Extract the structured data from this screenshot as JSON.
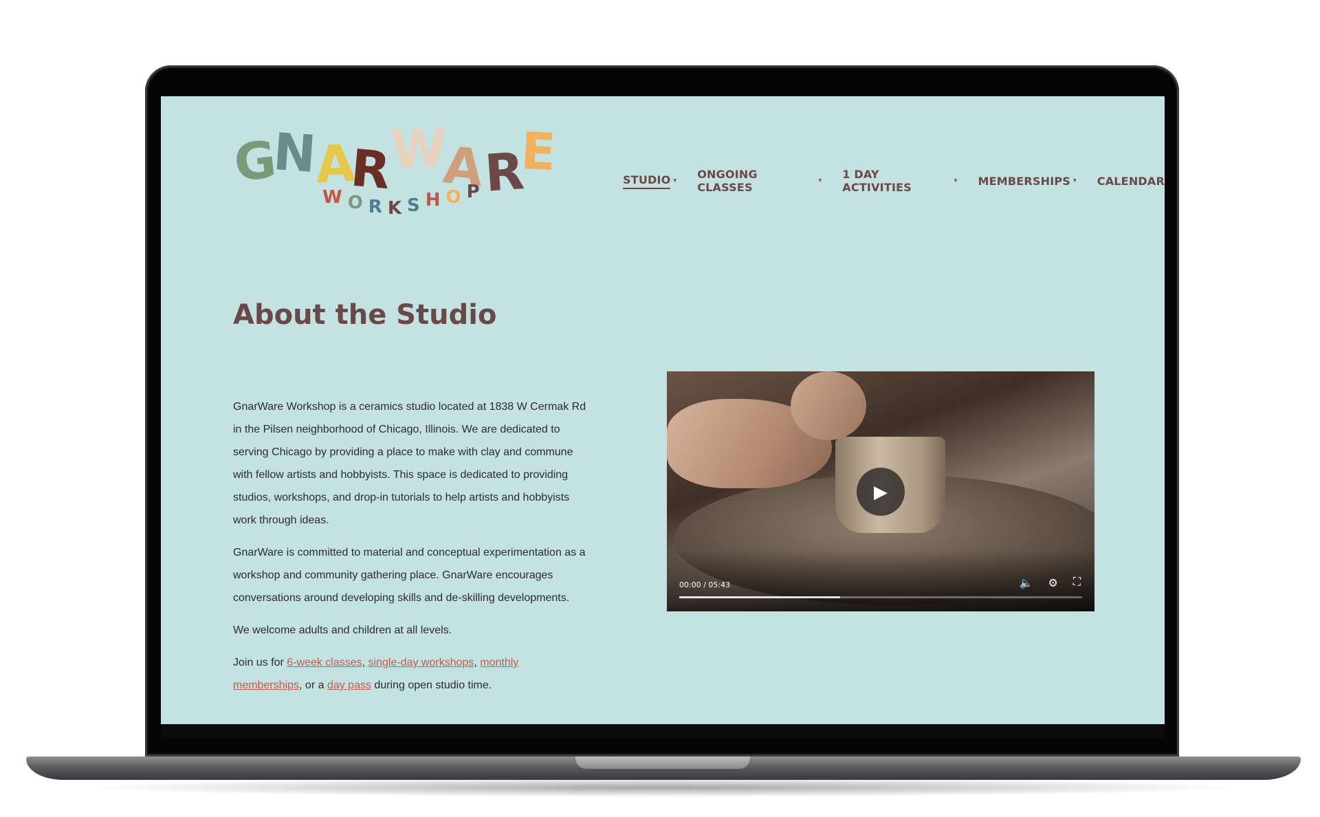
{
  "logo": {
    "main_letters": [
      "G",
      "N",
      "A",
      "R",
      "W",
      "A",
      "R",
      "E"
    ],
    "main_colors": [
      "#7a9a7a",
      "#6b8c8c",
      "#e5c84a",
      "#6b2e25",
      "#e8d2bf",
      "#cf9f7a",
      "#6b4848",
      "#f2b15e"
    ],
    "sub_letters": [
      "W",
      "O",
      "R",
      "K",
      "S",
      "H",
      "O",
      "P"
    ],
    "sub_colors": [
      "#c0564a",
      "#7a9a7a",
      "#4f7f8f",
      "#6b4848",
      "#4f7f8f",
      "#c0564a",
      "#f2b15e",
      "#6b4848"
    ]
  },
  "nav": {
    "items": [
      {
        "label": "STUDIO",
        "caret": true,
        "active": true
      },
      {
        "label": "ONGOING CLASSES",
        "caret": true,
        "active": false
      },
      {
        "label": "1 DAY ACTIVITIES",
        "caret": true,
        "active": false
      },
      {
        "label": "MEMBERSHIPS",
        "caret": true,
        "active": false
      },
      {
        "label": "CALENDAR",
        "caret": false,
        "active": false
      }
    ],
    "caret_glyph": "▾"
  },
  "page": {
    "title": "About the Studio",
    "paragraph1": "GnarWare Workshop is a ceramics studio located at 1838 W Cermak Rd in the Pilsen neighborhood of Chicago, Illinois. We are dedicated to serving Chicago by providing a place to make with clay and commune with fellow artists and hobbyists. This space is dedicated to providing studios, workshops, and drop-in tutorials to help artists and hobbyists work through ideas.",
    "paragraph2": "GnarWare is committed to material and conceptual experimentation as a workshop and community gathering place. GnarWare encourages conversations around developing skills and de-skilling developments.",
    "paragraph3": "We welcome adults and children at all levels.",
    "paragraph4": {
      "prefix": "Join us for ",
      "link1": "6-week classes",
      "sep1": ", ",
      "link2": "single-day workshops",
      "sep2": ", ",
      "link3": "monthly memberships",
      "sep3": ", or a ",
      "link4": "day pass",
      "suffix": " during open studio time."
    }
  },
  "video": {
    "time": "00:00 / 05:43",
    "buffered_fraction": 0.4,
    "play_icon": "▶",
    "volume_icon": "🔈",
    "settings_icon": "⚙",
    "fullscreen_icon": "⛶"
  },
  "colors": {
    "background": "#c3e2e1",
    "heading": "#6b4848",
    "link": "#c35a4a"
  }
}
